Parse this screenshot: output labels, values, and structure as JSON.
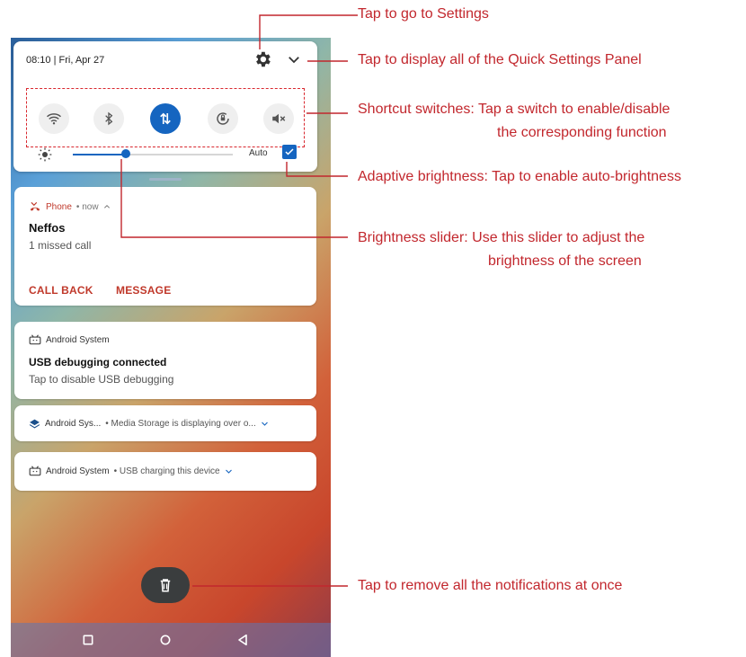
{
  "quick_settings": {
    "time_date": "08:10 | Fri, Apr 27",
    "auto_label": "Auto",
    "brightness_level_percent": 33,
    "tiles": [
      {
        "name": "wifi-icon",
        "active": false
      },
      {
        "name": "bluetooth-icon",
        "active": false
      },
      {
        "name": "mobile-data-icon",
        "active": true
      },
      {
        "name": "auto-rotate-icon",
        "active": false
      },
      {
        "name": "sound-mute-icon",
        "active": false
      }
    ]
  },
  "notifications": {
    "phone": {
      "app": "Phone",
      "meta": " • now",
      "title": "Neffos",
      "text": "1 missed call",
      "action_callback": "CALL BACK",
      "action_message": "MESSAGE"
    },
    "android_usb": {
      "app": "Android System",
      "title": "USB debugging connected",
      "text": "Tap to disable USB debugging"
    },
    "media_storage": {
      "app": "Android Sys...",
      "text": " • Media Storage is displaying over o..."
    },
    "usb_charging": {
      "app": "Android System",
      "text": " • USB charging this device"
    }
  },
  "callouts": {
    "settings": "Tap to go to Settings",
    "expand": "Tap to display all of the Quick Settings Panel",
    "shortcut_line1": "Shortcut switches: Tap a switch to enable/disable",
    "shortcut_line2": "the corresponding function",
    "adaptive": "Adaptive brightness: Tap to enable auto-brightness",
    "slider_line1": "Brightness slider: Use this slider to adjust the",
    "slider_line2": "brightness of the screen",
    "remove_all": "Tap to remove all the notifications at once"
  },
  "colors": {
    "accent": "#1565c0",
    "callout": "#c2272d",
    "action": "#c0392b"
  }
}
